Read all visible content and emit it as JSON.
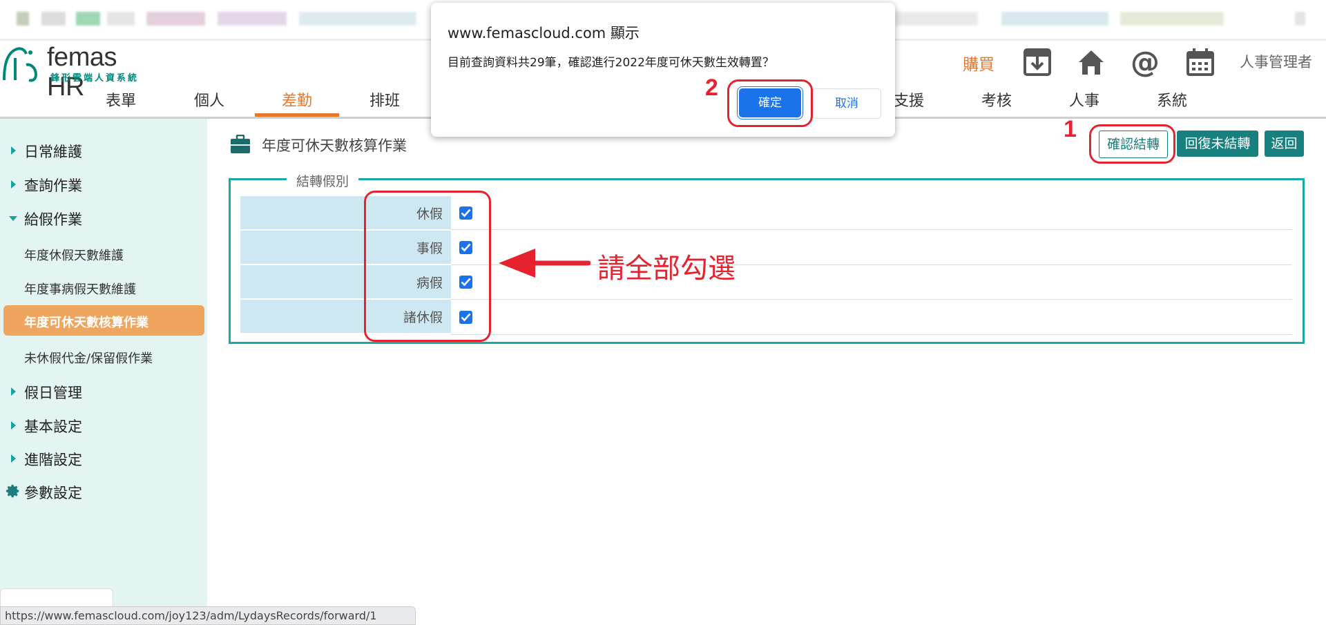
{
  "browser": {
    "status_url": "https://www.femascloud.com/joy123/adm/LydaysRecords/forward/1"
  },
  "header": {
    "logo_name": "femas HR",
    "logo_tagline": "鋒形雲端人資系統",
    "buy_label": "購買",
    "user_label": "人事管理者",
    "icons": [
      "download-icon",
      "home-icon",
      "at-icon",
      "calendar-icon"
    ]
  },
  "nav": {
    "items": [
      {
        "label": "表單"
      },
      {
        "label": "個人"
      },
      {
        "label": "差勤"
      },
      {
        "label": "排班"
      },
      {
        "label": "支援"
      },
      {
        "label": "考核"
      },
      {
        "label": "人事"
      },
      {
        "label": "系統"
      }
    ],
    "active": "差勤",
    "active_color": "#e8772e"
  },
  "sidebar": {
    "items": [
      {
        "label": "日常維護"
      },
      {
        "label": "查詢作業"
      },
      {
        "label": "給假作業"
      },
      {
        "label": "假日管理"
      },
      {
        "label": "基本設定"
      },
      {
        "label": "進階設定"
      },
      {
        "label": "參數設定"
      }
    ],
    "subitems": [
      {
        "label": "年度休假天數維護"
      },
      {
        "label": "年度事病假天數維護"
      },
      {
        "label": "年度可休天數核算作業"
      },
      {
        "label": "未休假代金/保留假作業"
      }
    ],
    "active_color": "#f0a55f"
  },
  "main": {
    "title": "年度可休天數核算作業",
    "buttons": {
      "confirm": "確認結轉",
      "restore": "回復未結轉",
      "back": "返回"
    },
    "fieldset_legend": "結轉假別",
    "rows": [
      {
        "label": "休假",
        "checked": true
      },
      {
        "label": "事假",
        "checked": true
      },
      {
        "label": "病假",
        "checked": true
      },
      {
        "label": "諸休假",
        "checked": true
      }
    ],
    "accent_color": "#18807f"
  },
  "dialog": {
    "title": "www.femascloud.com 顯示",
    "message": "目前查詢資料共29筆，確認進行2022年度可休天數生效轉置？",
    "ok_label": "確定",
    "cancel_label": "取消"
  },
  "annotations": {
    "step1": "1",
    "step2": "2",
    "note": "請全部勾選",
    "color": "#e5232f"
  }
}
